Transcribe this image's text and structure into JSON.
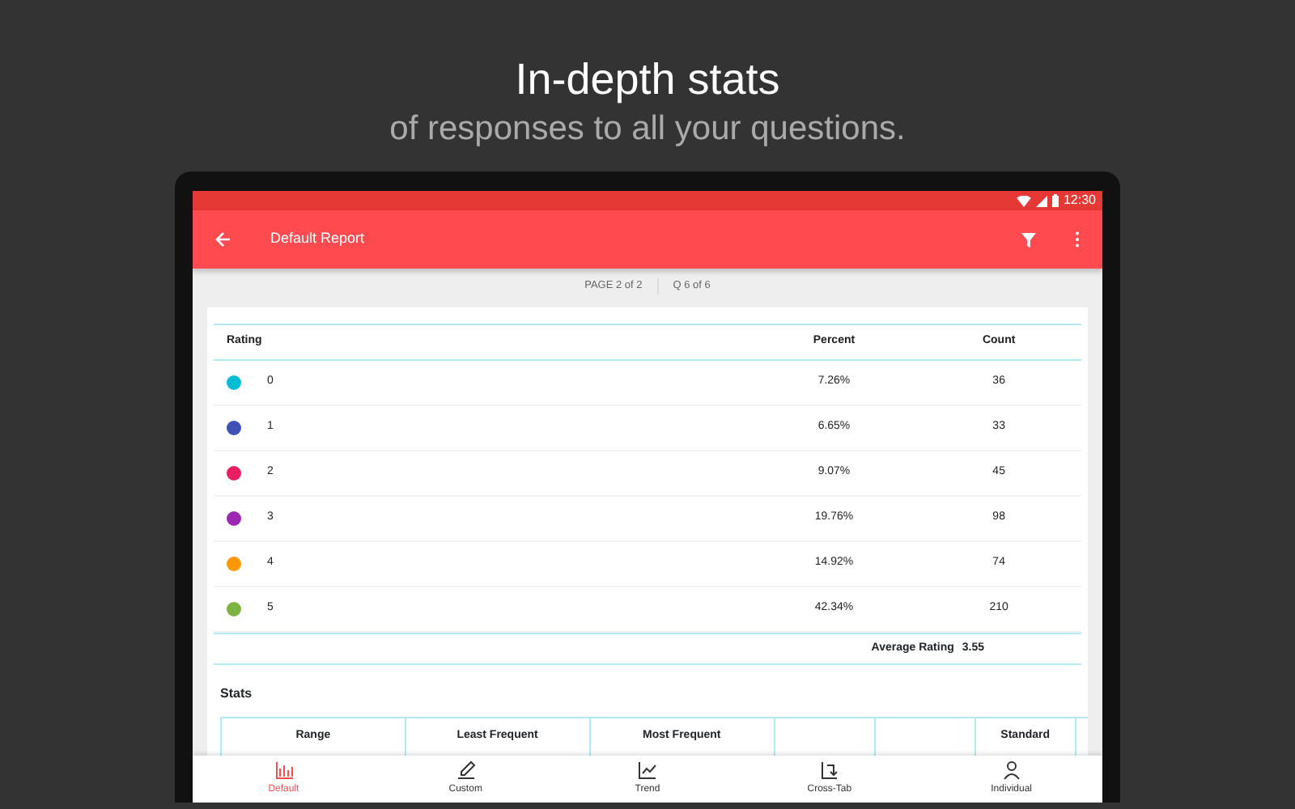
{
  "promo": {
    "title": "In-depth stats",
    "subtitle": "of responses to all your questions."
  },
  "status_bar": {
    "time": "12:30"
  },
  "app_bar": {
    "title": "Default Report"
  },
  "pager": {
    "page": "PAGE 2 of 2",
    "question": "Q 6 of 6"
  },
  "table": {
    "columns": [
      "Rating",
      "Percent",
      "Count"
    ],
    "rows": [
      {
        "rating": "0",
        "percent": "7.26%",
        "count": "36",
        "color": "#00bcd4"
      },
      {
        "rating": "1",
        "percent": "6.65%",
        "count": "33",
        "color": "#3f51b5"
      },
      {
        "rating": "2",
        "percent": "9.07%",
        "count": "45",
        "color": "#e91e63"
      },
      {
        "rating": "3",
        "percent": "19.76%",
        "count": "98",
        "color": "#9c27b0"
      },
      {
        "rating": "4",
        "percent": "14.92%",
        "count": "74",
        "color": "#ff9800"
      },
      {
        "rating": "5",
        "percent": "42.34%",
        "count": "210",
        "color": "#7cb342"
      }
    ],
    "average": {
      "label": "Average Rating",
      "value": "3.55"
    }
  },
  "stats": {
    "title": "Stats",
    "columns": [
      "Range",
      "Least Frequent",
      "Most Frequent",
      "Standard"
    ]
  },
  "bottom_nav": [
    {
      "label": "Default",
      "selected": true
    },
    {
      "label": "Custom",
      "selected": false
    },
    {
      "label": "Trend",
      "selected": false
    },
    {
      "label": "Cross-Tab",
      "selected": false
    },
    {
      "label": "Individual",
      "selected": false
    }
  ]
}
